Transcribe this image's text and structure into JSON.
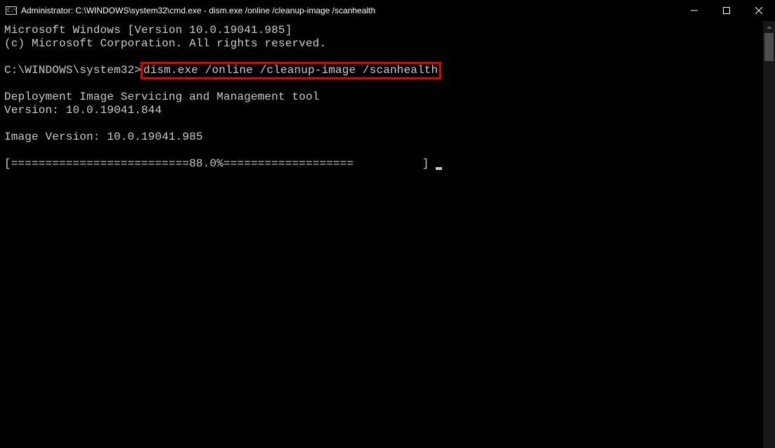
{
  "titlebar": {
    "icon_label": "cmd-icon",
    "text": "Administrator: C:\\WINDOWS\\system32\\cmd.exe - dism.exe  /online /cleanup-image /scanhealth"
  },
  "terminal": {
    "line1": "Microsoft Windows [Version 10.0.19041.985]",
    "line2": "(c) Microsoft Corporation. All rights reserved.",
    "prompt_prefix": "C:\\WINDOWS\\system32>",
    "command": "dism.exe /online /cleanup-image /scanhealth",
    "tool_line1": "Deployment Image Servicing and Management tool",
    "tool_line2": "Version: 10.0.19041.844",
    "image_version": "Image Version: 10.0.19041.985",
    "progress": "[==========================88.0%===================          ] ",
    "progress_percent": 88.0
  }
}
